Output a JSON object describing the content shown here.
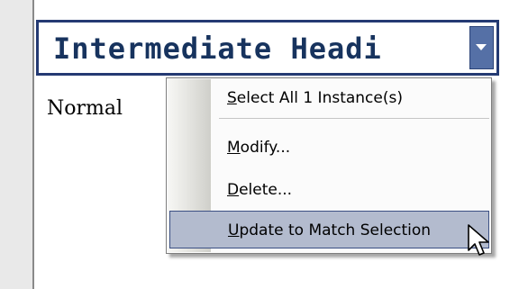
{
  "style_row": {
    "name": "Intermediate Headi",
    "dropdown_icon": "chevron-down-icon"
  },
  "normal_style": {
    "name": "Normal"
  },
  "context_menu": {
    "items": [
      {
        "label": "Select All 1 Instance(s)",
        "access_key": "S"
      },
      {
        "label": "Modify...",
        "access_key": "M"
      },
      {
        "label": "Delete...",
        "access_key": "D"
      },
      {
        "label": "Update to Match Selection",
        "access_key": "U",
        "highlighted": true
      }
    ]
  },
  "colors": {
    "style_border": "#243a73",
    "dropdown_button": "#5570a6",
    "highlight": "#b3bbce"
  },
  "cursor_icon": "arrow-pointer-icon"
}
